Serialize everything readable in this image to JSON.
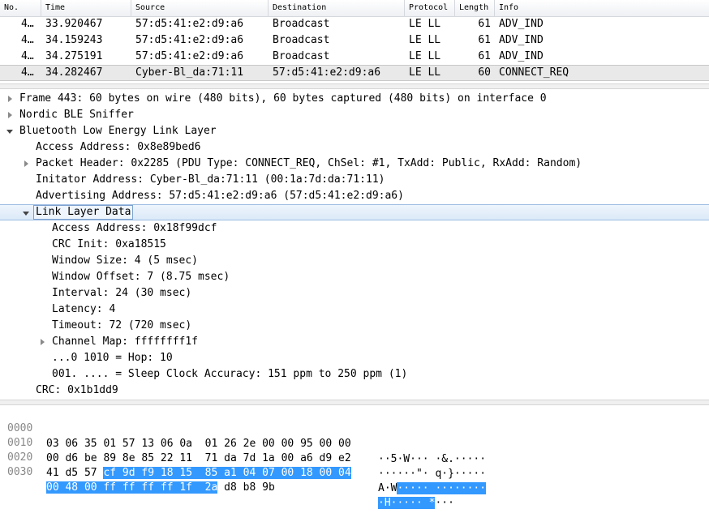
{
  "packet_list": {
    "columns": [
      "No.",
      "Time",
      "Source",
      "Destination",
      "Protocol",
      "Length",
      "Info"
    ],
    "rows": [
      {
        "no": "4…",
        "time": "33.920467",
        "source": "57:d5:41:e2:d9:a6",
        "destination": "Broadcast",
        "protocol": "LE LL",
        "length": "61",
        "info": "ADV_IND"
      },
      {
        "no": "4…",
        "time": "34.159243",
        "source": "57:d5:41:e2:d9:a6",
        "destination": "Broadcast",
        "protocol": "LE LL",
        "length": "61",
        "info": "ADV_IND"
      },
      {
        "no": "4…",
        "time": "34.275191",
        "source": "57:d5:41:e2:d9:a6",
        "destination": "Broadcast",
        "protocol": "LE LL",
        "length": "61",
        "info": "ADV_IND"
      },
      {
        "no": "4…",
        "time": "34.282467",
        "source": "Cyber-Bl_da:71:11",
        "destination": "57:d5:41:e2:d9:a6",
        "protocol": "LE LL",
        "length": "60",
        "info": "CONNECT_REQ"
      }
    ]
  },
  "details": {
    "frame": "Frame 443: 60 bytes on wire (480 bits), 60 bytes captured (480 bits) on interface 0",
    "nordic": "Nordic BLE Sniffer",
    "btle": "Bluetooth Low Energy Link Layer",
    "access_address": "Access Address: 0x8e89bed6",
    "packet_header": "Packet Header: 0x2285 (PDU Type: CONNECT_REQ, ChSel: #1, TxAdd: Public, RxAdd: Random)",
    "initiator_address": "Initator Address: Cyber-Bl_da:71:11 (00:1a:7d:da:71:11)",
    "advertising_address": "Advertising Address: 57:d5:41:e2:d9:a6 (57:d5:41:e2:d9:a6)",
    "link_layer_data": "Link Layer Data",
    "ll_access_address": "Access Address: 0x18f99dcf",
    "crc_init": "CRC Init: 0xa18515",
    "window_size": "Window Size: 4 (5 msec)",
    "window_offset": "Window Offset: 7 (8.75 msec)",
    "interval": "Interval: 24 (30 msec)",
    "latency": "Latency: 4",
    "timeout": "Timeout: 72 (720 msec)",
    "channel_map": "Channel Map: ffffffff1f",
    "hop": "...0 1010 = Hop: 10",
    "sleep_clock": "001. .... = Sleep Clock Accuracy: 151 ppm to 250 ppm (1)",
    "crc": "CRC: 0x1b1dd9"
  },
  "hex": {
    "rows": [
      {
        "offset": "0000",
        "b_pre": "03 06 35 01 57 13 06 0a  01 26 2e 00 00 95 00 00",
        "b_hl": "",
        "b_post": "",
        "a_pre": "··5·W··· ·&.·····",
        "a_hl": "",
        "a_post": ""
      },
      {
        "offset": "0010",
        "b_pre": "00 d6 be 89 8e 85 22 11  71 da 7d 1a 00 a6 d9 e2",
        "b_hl": "",
        "b_post": "",
        "a_pre": "······\"· q·}·····",
        "a_hl": "",
        "a_post": ""
      },
      {
        "offset": "0020",
        "b_pre": "41 d5 57 ",
        "b_hl": "cf 9d f9 18 15  85 a1 04 07 00 18 00 04",
        "b_post": "",
        "a_pre": "A·W",
        "a_hl": "····· ········",
        "a_post": ""
      },
      {
        "offset": "0030",
        "b_pre": "",
        "b_hl": "00 48 00 ff ff ff ff 1f  2a",
        "b_post": " d8 b8 9b",
        "a_pre": "",
        "a_hl": "·H····· *",
        "a_post": "···"
      }
    ]
  }
}
